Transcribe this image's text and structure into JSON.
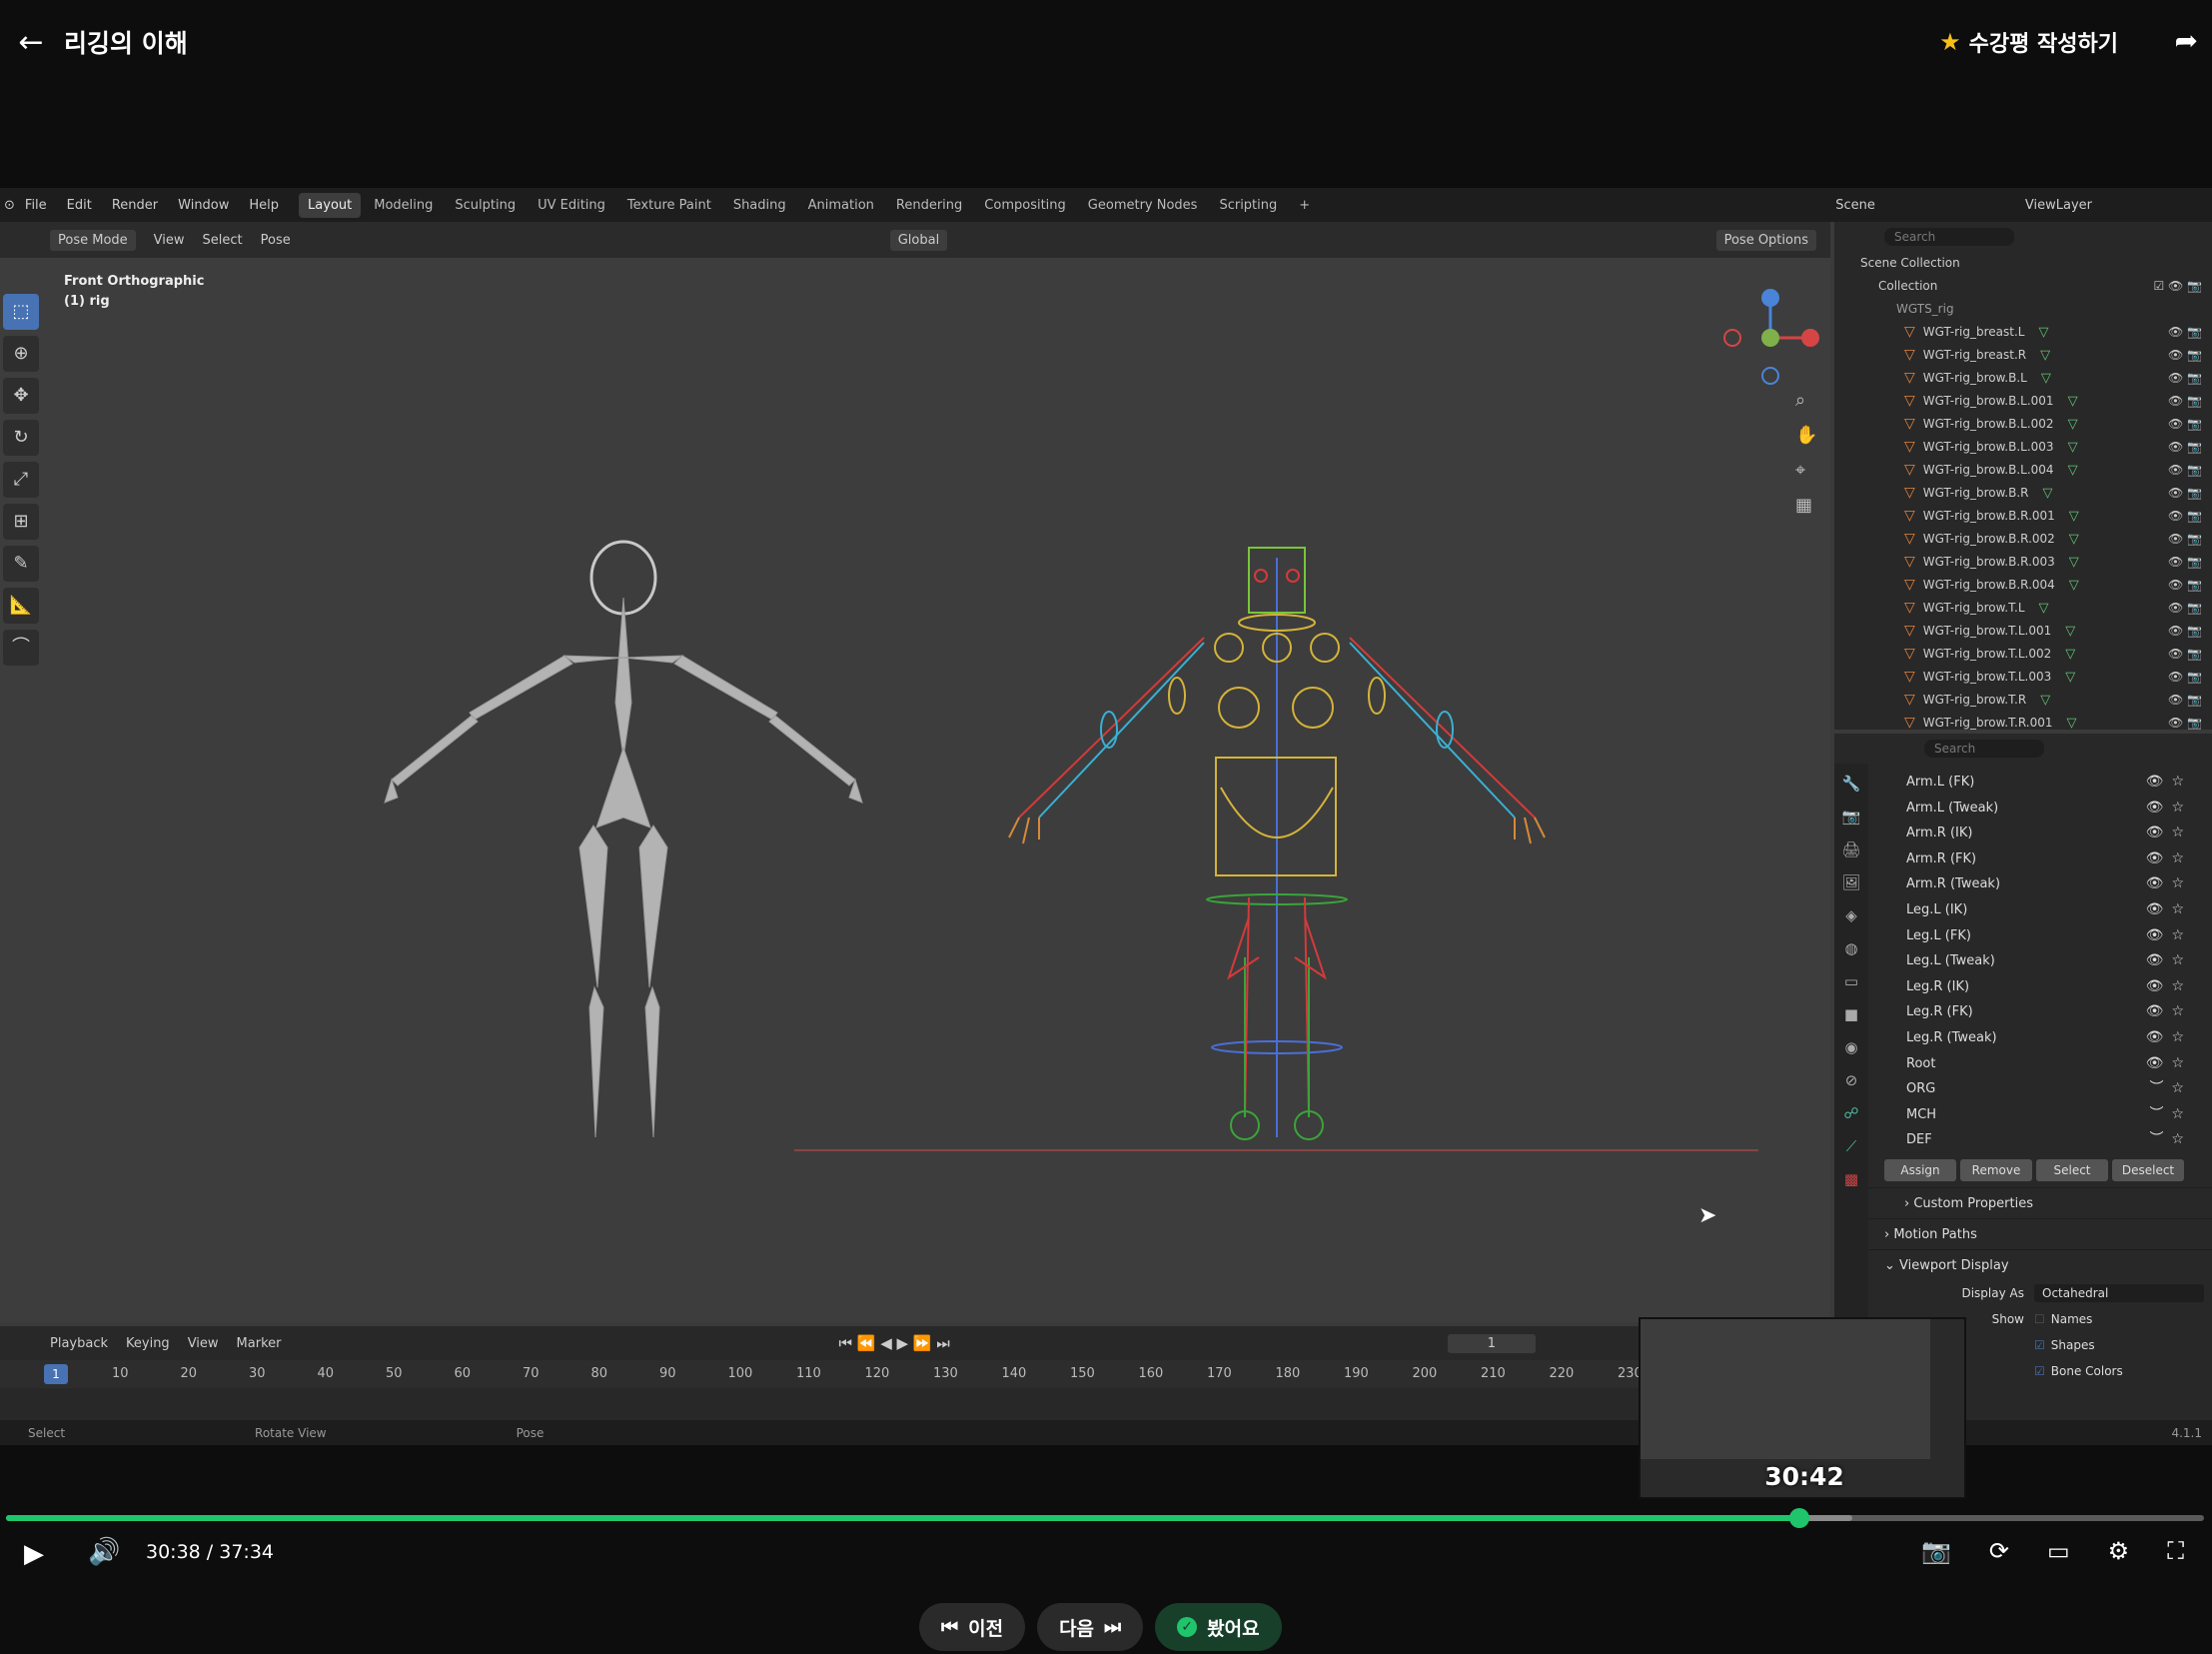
{
  "header": {
    "back_icon": "arrow-left-icon",
    "title": "리깅의 이해",
    "review_label": "수강평 작성하기",
    "share_icon": "share-arrow-icon"
  },
  "blender": {
    "menu": [
      "File",
      "Edit",
      "Render",
      "Window",
      "Help"
    ],
    "workspaces": [
      "Layout",
      "Modeling",
      "Sculpting",
      "UV Editing",
      "Texture Paint",
      "Shading",
      "Animation",
      "Rendering",
      "Compositing",
      "Geometry Nodes",
      "Scripting",
      "+"
    ],
    "scene": "Scene",
    "view_layer": "ViewLayer",
    "mode": "Pose Mode",
    "vp_menu": [
      "View",
      "Select",
      "Pose"
    ],
    "transform": "Global",
    "pose_options": "Pose Options",
    "view_label": "Front Orthographic",
    "object_label": "(1) rig",
    "outliner": {
      "search_placeholder": "Search",
      "scene_collection": "Scene Collection",
      "collection": "Collection",
      "wgts": "WGTS_rig",
      "items": [
        "WGT-rig_breast.L",
        "WGT-rig_breast.R",
        "WGT-rig_brow.B.L",
        "WGT-rig_brow.B.L.001",
        "WGT-rig_brow.B.L.002",
        "WGT-rig_brow.B.L.003",
        "WGT-rig_brow.B.L.004",
        "WGT-rig_brow.B.R",
        "WGT-rig_brow.B.R.001",
        "WGT-rig_brow.B.R.002",
        "WGT-rig_brow.B.R.003",
        "WGT-rig_brow.B.R.004",
        "WGT-rig_brow.T.L",
        "WGT-rig_brow.T.L.001",
        "WGT-rig_brow.T.L.002",
        "WGT-rig_brow.T.L.003",
        "WGT-rig_brow.T.R",
        "WGT-rig_brow.T.R.001"
      ]
    },
    "properties": {
      "search_placeholder": "Search",
      "bone_collections": [
        "Arm.L (FK)",
        "Arm.L (Tweak)",
        "Arm.R (IK)",
        "Arm.R (FK)",
        "Arm.R (Tweak)",
        "Leg.L (IK)",
        "Leg.L (FK)",
        "Leg.L (Tweak)",
        "Leg.R (IK)",
        "Leg.R (FK)",
        "Leg.R (Tweak)",
        "Root",
        "ORG",
        "MCH",
        "DEF"
      ],
      "buttons": [
        "Assign",
        "Remove",
        "Select",
        "Deselect"
      ],
      "panels": [
        "Custom Properties",
        "Motion Paths",
        "Viewport Display"
      ],
      "display_as_label": "Display As",
      "display_as": "Octahedral",
      "show_label": "Show",
      "names": "Names",
      "shapes": "Shapes",
      "bone_colors": "Bone Colors",
      "version": "4.1.1"
    },
    "timeline": {
      "menu": [
        "Playback",
        "Keying",
        "View",
        "Marker"
      ],
      "current_frame": "1",
      "ticks": [
        "10",
        "20",
        "30",
        "40",
        "50",
        "60",
        "70",
        "80",
        "90",
        "100",
        "110",
        "120",
        "130",
        "140",
        "150",
        "160",
        "170",
        "180",
        "190",
        "200",
        "210",
        "220",
        "230"
      ]
    },
    "status": [
      "Select",
      "Rotate View",
      "Pose"
    ]
  },
  "player": {
    "preview_time": "30:42",
    "time": "30:38 / 37:34",
    "progress_fraction": 0.8157,
    "buffered_fraction": 0.84,
    "prev_label": "이전",
    "next_label": "다음",
    "seen_label": "봤어요"
  }
}
